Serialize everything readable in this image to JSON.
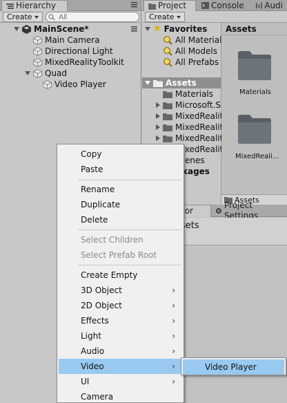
{
  "hierarchy": {
    "tab_label": "Hierarchy",
    "create_label": "Create",
    "search_placeholder": "All",
    "scene_name": "MainScene*",
    "items": [
      {
        "label": "Main Camera"
      },
      {
        "label": "Directional Light"
      },
      {
        "label": "MixedRealityToolkit"
      },
      {
        "label": "Quad"
      },
      {
        "label": "Video Player"
      }
    ]
  },
  "project": {
    "tabs": [
      "Project",
      "Console",
      "Audi"
    ],
    "create_label": "Create",
    "favorites_label": "Favorites",
    "favorites": [
      "All Materials",
      "All Models",
      "All Prefabs"
    ],
    "assets_label": "Assets",
    "asset_folders": [
      "Materials",
      "Microsoft.Sp",
      "MixedRealit",
      "MixedRealit",
      "MixedRealit",
      "MixedRealit",
      "enes",
      "kages"
    ],
    "breadcrumb": "Assets",
    "grid_items": [
      "Materials",
      "MixedReali..."
    ],
    "status_path": "Assets"
  },
  "inspector": {
    "tab_left": "tor",
    "tab_settings": "Project Settings",
    "title": "sets"
  },
  "context_menu": {
    "items": [
      {
        "label": "Copy",
        "disabled": false,
        "submenu": false
      },
      {
        "label": "Paste",
        "disabled": false,
        "submenu": false
      },
      {
        "label": "Rename",
        "disabled": false,
        "submenu": false
      },
      {
        "label": "Duplicate",
        "disabled": false,
        "submenu": false
      },
      {
        "label": "Delete",
        "disabled": false,
        "submenu": false
      },
      {
        "label": "Select Children",
        "disabled": true,
        "submenu": false
      },
      {
        "label": "Select Prefab Root",
        "disabled": true,
        "submenu": false
      },
      {
        "label": "Create Empty",
        "disabled": false,
        "submenu": false
      },
      {
        "label": "3D Object",
        "disabled": false,
        "submenu": true
      },
      {
        "label": "2D Object",
        "disabled": false,
        "submenu": true
      },
      {
        "label": "Effects",
        "disabled": false,
        "submenu": true
      },
      {
        "label": "Light",
        "disabled": false,
        "submenu": true
      },
      {
        "label": "Audio",
        "disabled": false,
        "submenu": true
      },
      {
        "label": "Video",
        "disabled": false,
        "submenu": true,
        "highlighted": true
      },
      {
        "label": "UI",
        "disabled": false,
        "submenu": true
      },
      {
        "label": "Camera",
        "disabled": false,
        "submenu": false
      }
    ],
    "submenu_arrow": "›"
  },
  "submenu": {
    "items": [
      {
        "label": "Video Player"
      }
    ]
  },
  "colors": {
    "highlight": "#99c9ef",
    "panel": "#c8c8c8",
    "menu_bg": "#f0f0f0"
  }
}
